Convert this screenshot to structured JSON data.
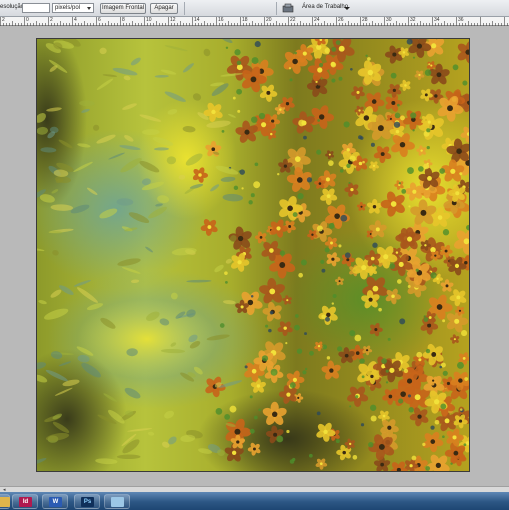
{
  "options_bar": {
    "resolution_label": "esolução:",
    "resolution_value": "",
    "resolution_unit": "pixels/pol",
    "front_image_button": "Imagem Frontal",
    "clear_button": "Apagar",
    "workspace_label": "Área de Trabalho"
  },
  "ruler": {
    "labels": [
      "2",
      "0",
      "2",
      "4",
      "6",
      "8",
      "10",
      "12",
      "14",
      "16",
      "18",
      "20",
      "22",
      "24",
      "26",
      "28",
      "30",
      "32",
      "34",
      "36"
    ]
  },
  "document": {
    "name": "floral abstract painting",
    "colors": {
      "left_wash": "#b9c43a",
      "teal": "#4f8a78",
      "dark": "#3d3a1c",
      "orange": "#d9801f",
      "yellow": "#e8d82a",
      "green": "#6a9b2a"
    }
  },
  "taskbar": {
    "apps": [
      {
        "name": "folder",
        "label": ""
      },
      {
        "name": "indesign",
        "label": "Id"
      },
      {
        "name": "word",
        "label": "W"
      },
      {
        "name": "photoshop",
        "label": "Ps"
      },
      {
        "name": "explorer",
        "label": ""
      }
    ]
  }
}
